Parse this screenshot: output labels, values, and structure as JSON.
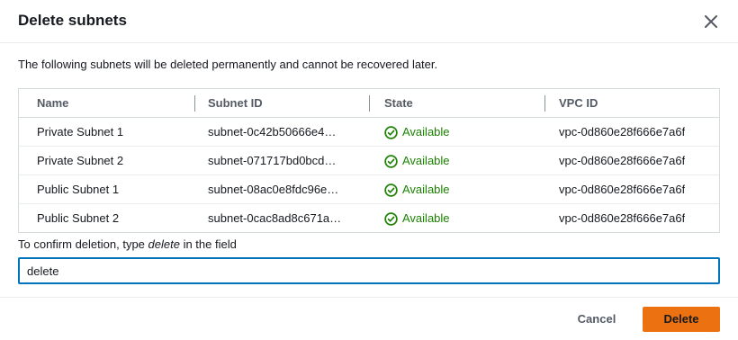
{
  "modal": {
    "title": "Delete subnets",
    "description": "The following subnets will be deleted permanently and cannot be recovered later."
  },
  "table": {
    "columns": [
      "Name",
      "Subnet ID",
      "State",
      "VPC ID"
    ],
    "rows": [
      {
        "name": "Private Subnet 1",
        "subnet_id": "subnet-0c42b50666e4…",
        "state": "Available",
        "vpc_id": "vpc-0d860e28f666e7a6f"
      },
      {
        "name": "Private Subnet 2",
        "subnet_id": "subnet-071717bd0bcd…",
        "state": "Available",
        "vpc_id": "vpc-0d860e28f666e7a6f"
      },
      {
        "name": "Public Subnet 1",
        "subnet_id": "subnet-08ac0e8fdc96e…",
        "state": "Available",
        "vpc_id": "vpc-0d860e28f666e7a6f"
      },
      {
        "name": "Public Subnet 2",
        "subnet_id": "subnet-0cac8ad8c671a…",
        "state": "Available",
        "vpc_id": "vpc-0d860e28f666e7a6f"
      }
    ]
  },
  "confirm": {
    "label_before": "To confirm deletion, type ",
    "label_keyword": "delete",
    "label_after": " in the field",
    "value": "delete"
  },
  "footer": {
    "cancel_label": "Cancel",
    "delete_label": "Delete"
  },
  "icons": {
    "close": "close-icon",
    "status_available": "check-circle-icon"
  },
  "colors": {
    "accent": "#ec7211",
    "success": "#1d8102",
    "focus": "#0073bb"
  }
}
